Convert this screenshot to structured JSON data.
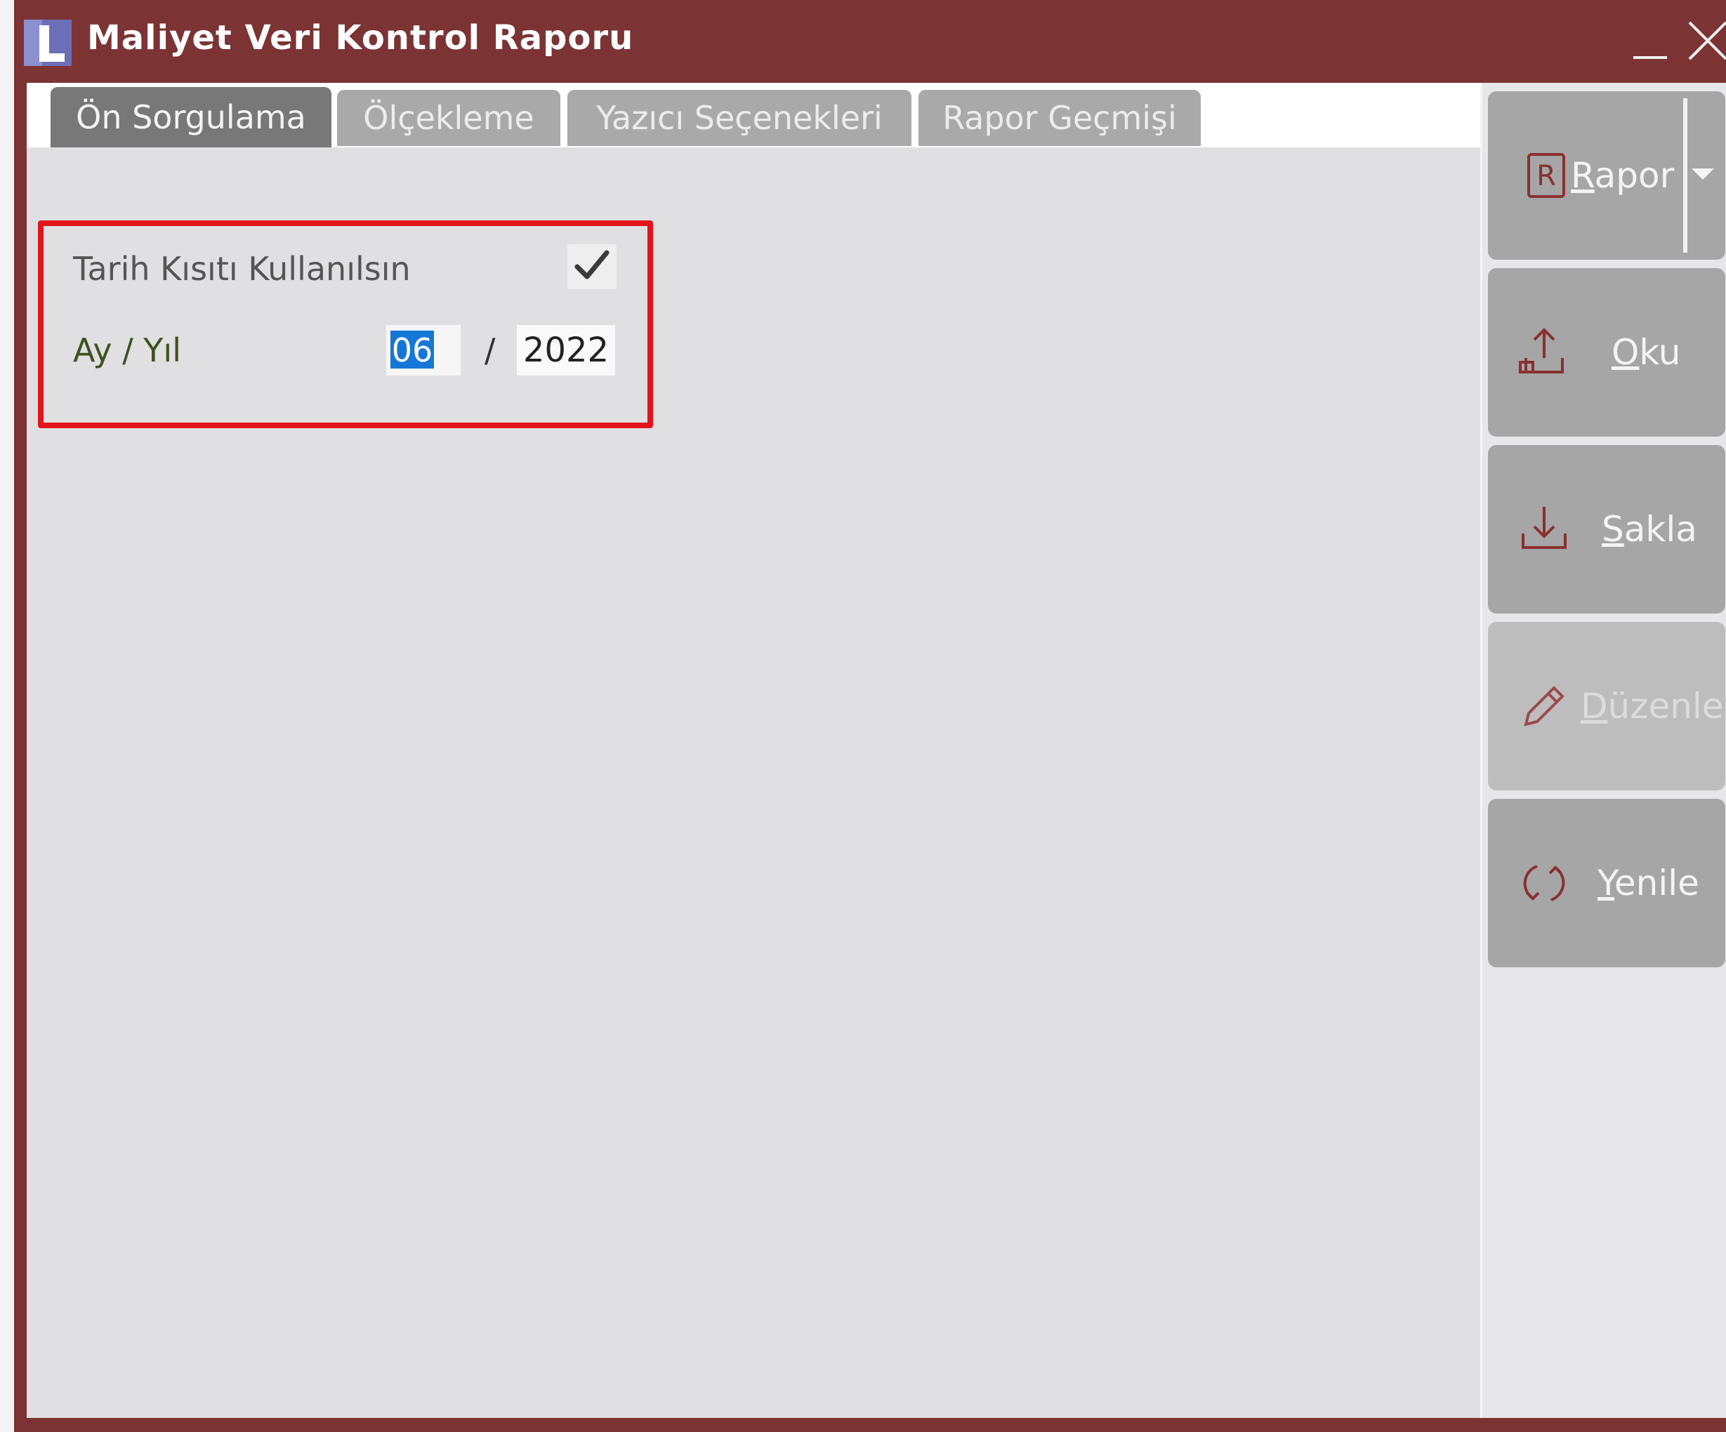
{
  "window": {
    "title": "Maliyet Veri Kontrol Raporu",
    "minimize_icon": "minimize-icon",
    "close_icon": "close-icon",
    "app_icon": "app-logo-icon",
    "frame_color": "#7c3333"
  },
  "tabs": [
    {
      "label": "Ön Sorgulama",
      "active": true
    },
    {
      "label": "Ölçekleme",
      "active": false
    },
    {
      "label": "Yazıcı Seçenekleri",
      "active": false
    },
    {
      "label": "Rapor Geçmişi",
      "active": false
    }
  ],
  "filters": {
    "date_restriction_label": "Tarih Kısıtı Kullanılsın",
    "date_restriction_checked": true,
    "month_year_label": "Ay / Yıl",
    "month_value": "06",
    "separator": "/",
    "year_value": "2022",
    "highlight_color": "#e3141c"
  },
  "actions": [
    {
      "label_underlined": "R",
      "label_rest": "apor",
      "icon": "report-icon",
      "enabled": true,
      "has_dropdown": true
    },
    {
      "label_underlined": "O",
      "label_rest": "ku",
      "icon": "upload-icon",
      "enabled": true
    },
    {
      "label_underlined": "S",
      "label_rest": "akla",
      "icon": "download-icon",
      "enabled": true
    },
    {
      "label_underlined": "D",
      "label_rest": "üzenle",
      "icon": "pencil-icon",
      "enabled": false
    },
    {
      "label_underlined": "Y",
      "label_rest": "enile",
      "icon": "refresh-icon",
      "enabled": true
    }
  ]
}
